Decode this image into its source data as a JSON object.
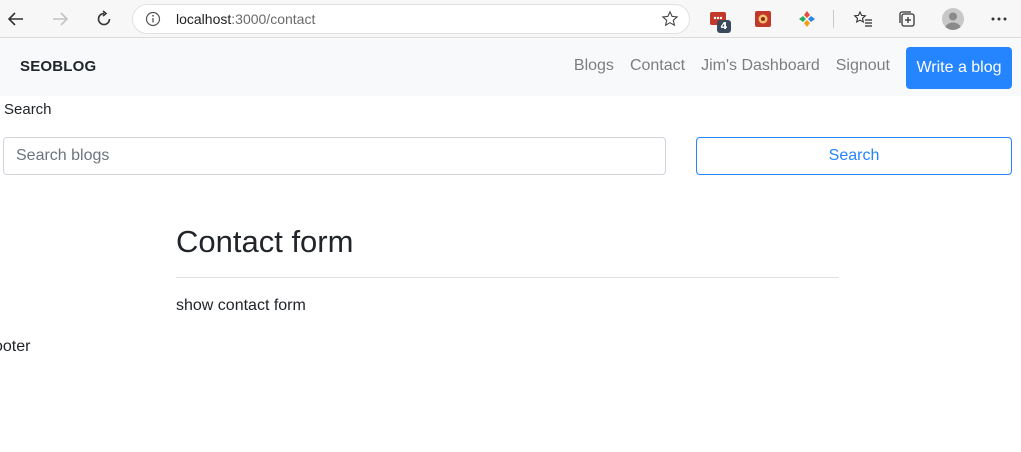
{
  "browser": {
    "url_host": "localhost",
    "url_path": ":3000/contact",
    "extension_badge": "4"
  },
  "navbar": {
    "brand": "SEOBLOG",
    "links": [
      "Blogs",
      "Contact",
      "Jim's Dashboard",
      "Signout"
    ],
    "write_button": "Write a blog"
  },
  "search": {
    "label": "Search",
    "placeholder": "Search blogs",
    "value": "",
    "button": "Search"
  },
  "main": {
    "title": "Contact form",
    "body": "show contact form"
  },
  "footer": {
    "text": "ooter"
  },
  "colors": {
    "primary": "#2584ff",
    "navbar_bg": "#f8f9fa",
    "muted_link": "#7f7f7f"
  },
  "icons": [
    "back-arrow-icon",
    "forward-arrow-icon",
    "reload-icon",
    "info-icon",
    "star-icon",
    "favorites-icon",
    "collections-icon",
    "more-icon"
  ]
}
